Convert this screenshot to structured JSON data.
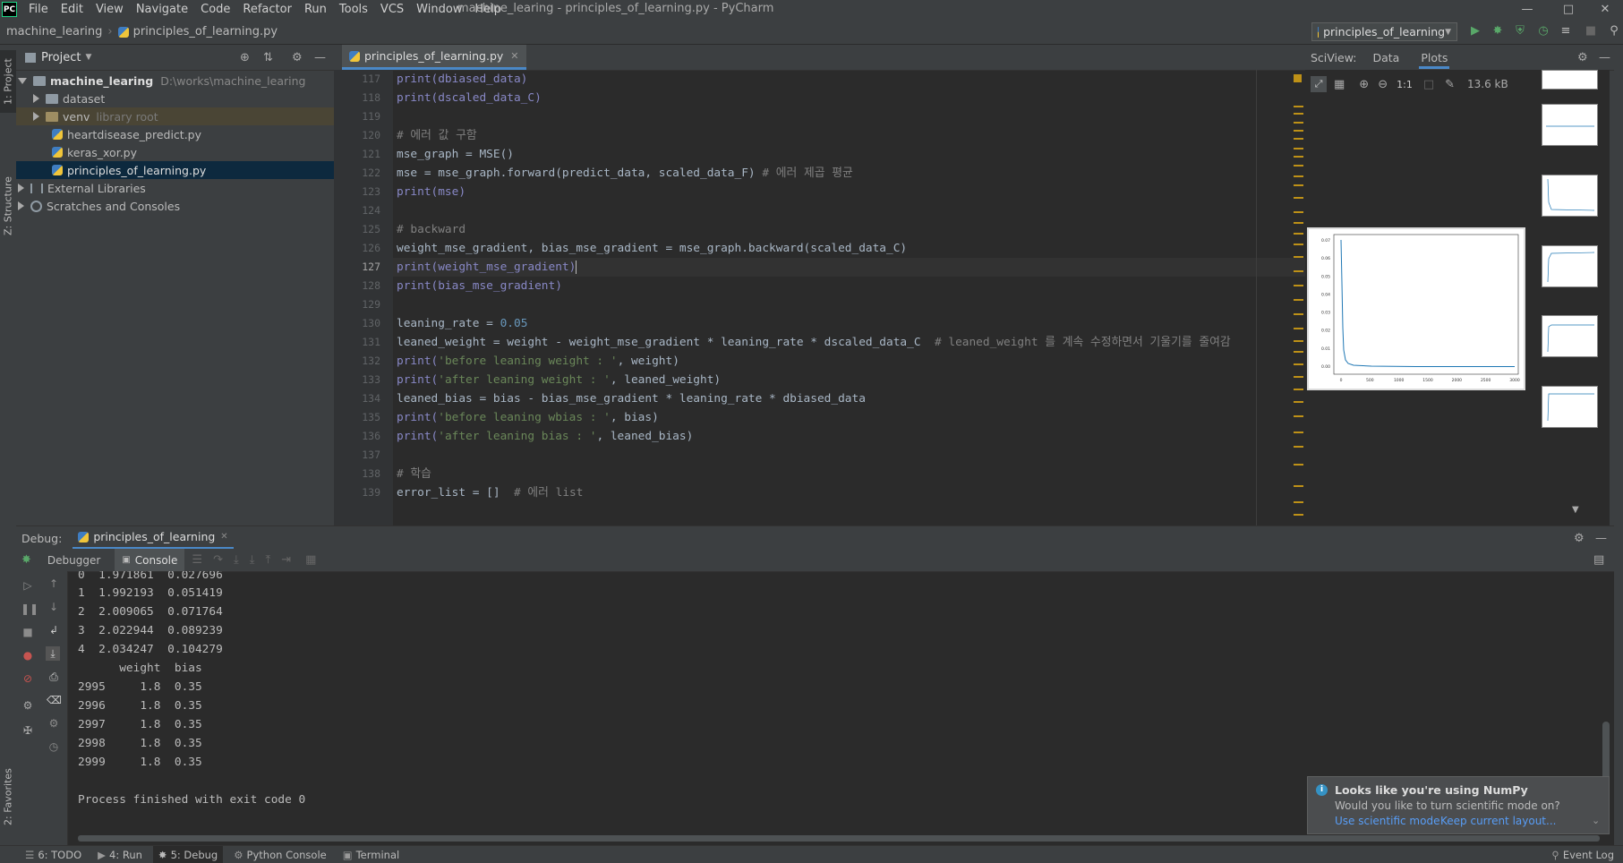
{
  "menubar": {
    "items": [
      "File",
      "Edit",
      "View",
      "Navigate",
      "Code",
      "Refactor",
      "Run",
      "Tools",
      "VCS",
      "Window",
      "Help"
    ],
    "title": "machine_learing - principles_of_learning.py - PyCharm"
  },
  "navbar": {
    "project": "machine_learing",
    "file": "principles_of_learning.py",
    "run_config": "principles_of_learning"
  },
  "left_stripe": {
    "project_tab": "1: Project",
    "structure_tab": "Z: Structure",
    "favorites_tab": "2: Favorites"
  },
  "project": {
    "title": "Project",
    "root_name": "machine_learing",
    "root_path": "D:\\works\\machine_learing",
    "items": [
      {
        "label": "dataset",
        "extra": ""
      },
      {
        "label": "venv",
        "extra": "library root"
      },
      {
        "label": "heartdisease_predict.py",
        "extra": ""
      },
      {
        "label": "keras_xor.py",
        "extra": ""
      },
      {
        "label": "principles_of_learning.py",
        "extra": ""
      }
    ],
    "external": "External Libraries",
    "scratches": "Scratches and Consoles"
  },
  "editor": {
    "tab": "principles_of_learning.py",
    "line_numbers": [
      "117",
      "118",
      "119",
      "120",
      "121",
      "122",
      "123",
      "124",
      "125",
      "126",
      "127",
      "128",
      "129",
      "130",
      "131",
      "132",
      "133",
      "134",
      "135",
      "136",
      "137",
      "138",
      "139"
    ],
    "current_line": "127",
    "tokens": {
      "l117": "print(dbiased_data)",
      "l118": "print(dscaled_data_C)",
      "l120": "# 에러 값 구함",
      "l121": "mse_graph = MSE()",
      "l122a": "mse = mse_graph.forward(predict_data, scaled_data_F)",
      "l122b": " # 에러 제곱 평균",
      "l123": "print(mse)",
      "l125": "# backward",
      "l126": "weight_mse_gradient, bias_mse_gradient = mse_graph.backward(scaled_data_C)",
      "l127": "print(weight_mse_gradient)",
      "l128": "print(bias_mse_gradient)",
      "l130a": "leaning_rate = ",
      "l130b": "0.05",
      "l131a": "leaned_weight = weight - weight_mse_gradient * leaning_rate * dscaled_data_C  ",
      "l131b": "# leaned_weight 를 계속 수정하면서 기울기를 줄여감",
      "l132a": "print(",
      "l132b": "'before leaning weight : '",
      "l132c": ", weight)",
      "l133b": "'after leaning weight : '",
      "l133c": ", leaned_weight)",
      "l134": "leaned_bias = bias - bias_mse_gradient * leaning_rate * dbiased_data",
      "l135b": "'before leaning wbias : '",
      "l135c": ", bias)",
      "l136b": "'after leaning bias : '",
      "l136c": ", leaned_bias)",
      "l138": "# 학습",
      "l139a": "error_list = []  ",
      "l139b": "# 에러 list"
    }
  },
  "sciview": {
    "label": "SciView:",
    "tabs": [
      "Data",
      "Plots"
    ],
    "active_tab": "Plots",
    "size": "13.6 kB",
    "zoom_label": "1:1",
    "plot": {
      "y_ticks": [
        "0.07",
        "0.06",
        "0.05",
        "0.04",
        "0.03",
        "0.02",
        "0.01",
        "0.00"
      ],
      "x_ticks": [
        "0",
        "500",
        "1000",
        "1500",
        "2000",
        "2500",
        "3000"
      ]
    }
  },
  "debug": {
    "label": "Debug:",
    "session": "principles_of_learning",
    "tabs": [
      "Debugger",
      "Console"
    ],
    "console_lines": [
      "0  1.971861  0.027696",
      "1  1.992193  0.051419",
      "2  2.009065  0.071764",
      "3  2.022944  0.089239",
      "4  2.034247  0.104279",
      "      weight  bias",
      "2995     1.8  0.35",
      "2996     1.8  0.35",
      "2997     1.8  0.35",
      "2998     1.8  0.35",
      "2999     1.8  0.35",
      "",
      "Process finished with exit code 0"
    ]
  },
  "notification": {
    "title": "Looks like you're using NumPy",
    "body": "Would you like to turn scientific mode on?",
    "action1": "Use scientific mode",
    "action2": "Keep current layout..."
  },
  "statusbar": {
    "todo": "6: TODO",
    "run": "4: Run",
    "debug": "5: Debug",
    "python_console": "Python Console",
    "terminal": "Terminal",
    "event_log": "Event Log"
  },
  "colors": {
    "accent": "#4a88c7",
    "run_green": "#59a869",
    "notif_link": "#589df6"
  }
}
